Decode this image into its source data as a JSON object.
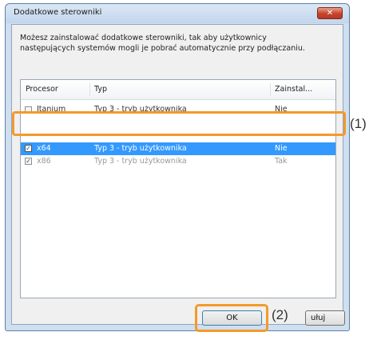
{
  "dialog": {
    "title": "Dodatkowe sterowniki",
    "close_glyph": "✕",
    "description_line1": "Możesz zainstalować dodatkowe sterowniki, tak aby użytkownicy",
    "description_line2": "następujących systemów mogli je pobrać automatycznie przy podłączaniu."
  },
  "list": {
    "headers": [
      "Procesor",
      "Typ",
      "Zainstal..."
    ],
    "rows": [
      {
        "processor": "Itanium",
        "type": "Typ 3 - tryb użytkownika",
        "installed": "Nie",
        "checked": false
      },
      {
        "processor": "x64",
        "type": "Typ 3 - tryb użytkownika",
        "installed": "Nie",
        "checked": true
      },
      {
        "processor": "x86",
        "type": "Typ 3 - tryb użytkownika",
        "installed": "Tak",
        "checked": true
      }
    ]
  },
  "callouts": {
    "row_label": "(1)",
    "button_label": "(2)"
  },
  "buttons": {
    "ok_label": "OK",
    "cancel_label_visible": "ułuj"
  },
  "colors": {
    "selection": "#3399ff",
    "callout_border": "#f39a2b",
    "close_button": "#c7432a"
  }
}
